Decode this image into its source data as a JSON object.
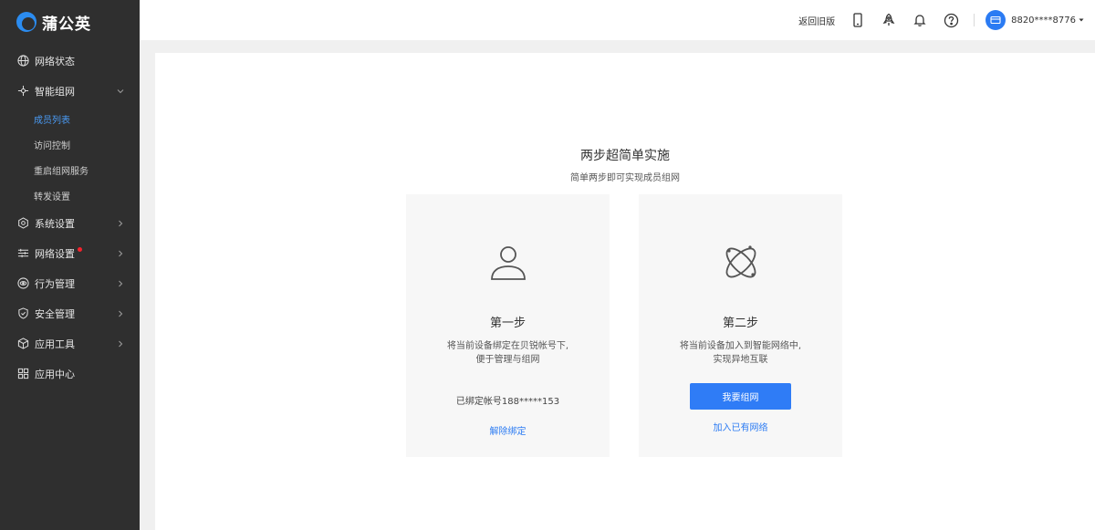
{
  "app": {
    "logo_text": "蒲公英"
  },
  "sidebar": {
    "items": [
      {
        "label": "网络状态",
        "icon": "globe-icon"
      },
      {
        "label": "智能组网",
        "icon": "network-icon",
        "expanded": true,
        "children": [
          {
            "label": "成员列表",
            "active": true
          },
          {
            "label": "访问控制"
          },
          {
            "label": "重启组网服务"
          },
          {
            "label": "转发设置"
          }
        ]
      },
      {
        "label": "系统设置",
        "icon": "gear-icon"
      },
      {
        "label": "网络设置",
        "icon": "sliders-icon",
        "badge": "red-dot"
      },
      {
        "label": "行为管理",
        "icon": "eye-icon"
      },
      {
        "label": "安全管理",
        "icon": "shield-icon"
      },
      {
        "label": "应用工具",
        "icon": "cube-icon"
      },
      {
        "label": "应用中心",
        "icon": "grid-icon"
      }
    ]
  },
  "header": {
    "back_link": "返回旧版",
    "icons": [
      "phone-icon",
      "rocket-icon",
      "bell-icon",
      "help-icon"
    ],
    "user_name": "8820****8776"
  },
  "main": {
    "headline": "两步超简单实施",
    "subline": "简单两步即可实现成员组网",
    "step1": {
      "title": "第一步",
      "desc_line1": "将当前设备绑定在贝锐帐号下,",
      "desc_line2": "便于管理与组网",
      "bound_text": "已绑定帐号188*****153",
      "link": "解除绑定"
    },
    "step2": {
      "title": "第二步",
      "desc_line1": "将当前设备加入到智能网络中,",
      "desc_line2": "实现异地互联",
      "button": "我要组网",
      "link": "加入已有网络"
    }
  },
  "colors": {
    "accent": "#2f7cf6",
    "sidebar_bg": "#2f2f2f",
    "active_sub": "#4a9bf5",
    "badge": "#f5222d"
  }
}
